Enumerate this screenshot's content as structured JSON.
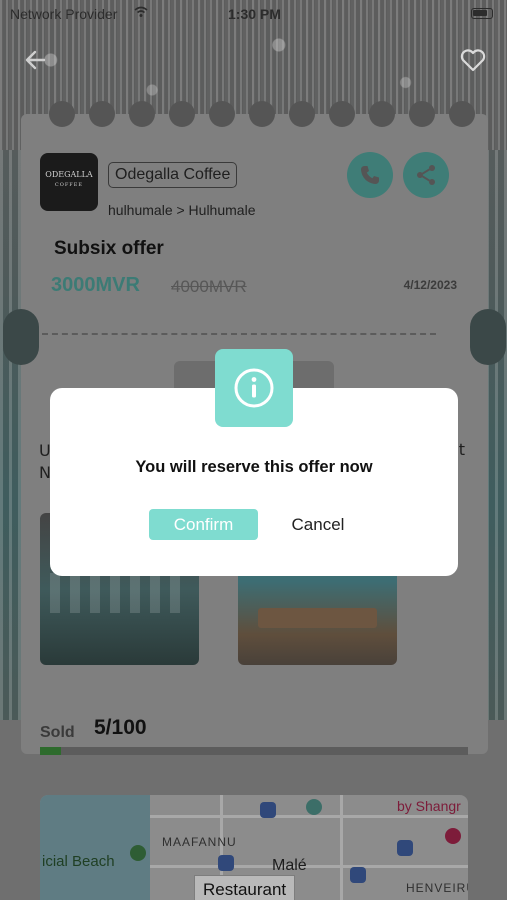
{
  "status_bar": {
    "carrier": "Network Provider",
    "time": "1:30 PM"
  },
  "shop": {
    "logo_text": "ODEGALLA",
    "logo_sub": "COFFEE",
    "name": "Odegalla Coffee",
    "location": "hulhumale > Hulhumale"
  },
  "offer": {
    "title": "Subsix offer",
    "price": "3000MVR",
    "original_price": "4000MVR",
    "date": "4/12/2023",
    "desc_left_1": "U",
    "desc_left_2": "N",
    "desc_right": "t"
  },
  "sold": {
    "label": "Sold",
    "count": "5/100",
    "fraction": 0.05
  },
  "map": {
    "beach": "icial Beach",
    "district_1": "MAAFANNU",
    "city": "Malé",
    "district_2": "HENVEIRU",
    "poi": "by Shangr",
    "tag": "Restaurant"
  },
  "dialog": {
    "message": "You will reserve this offer now",
    "confirm_label": "Confirm",
    "cancel_label": "Cancel"
  },
  "colors": {
    "accent": "#7fdcd0",
    "accent_dark": "#3f7d77"
  },
  "icons": {
    "back": "arrow-left-icon",
    "favorite": "heart-icon",
    "call": "phone-icon",
    "share": "share-icon",
    "info": "info-icon"
  }
}
